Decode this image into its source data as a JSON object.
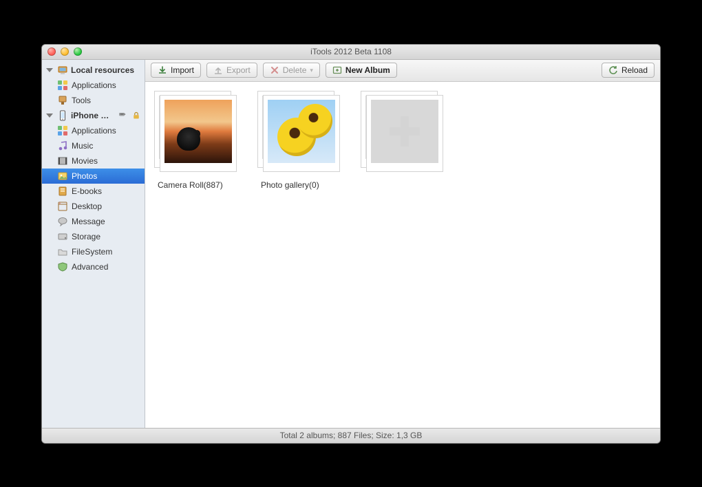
{
  "window": {
    "title": "iTools 2012 Beta 1108"
  },
  "sidebar": {
    "group1": {
      "label": "Local resources",
      "items": [
        {
          "label": "Applications"
        },
        {
          "label": "Tools"
        }
      ]
    },
    "group2": {
      "label": "iPhone de...",
      "items": [
        {
          "label": "Applications"
        },
        {
          "label": "Music"
        },
        {
          "label": "Movies"
        },
        {
          "label": "Photos"
        },
        {
          "label": "E-books"
        },
        {
          "label": "Desktop"
        },
        {
          "label": "Message"
        },
        {
          "label": "Storage"
        },
        {
          "label": "FileSystem"
        },
        {
          "label": "Advanced"
        }
      ]
    }
  },
  "toolbar": {
    "import": "Import",
    "export": "Export",
    "delete": "Delete",
    "new_album": "New Album",
    "reload": "Reload"
  },
  "albums": [
    {
      "label": "Camera Roll(887)"
    },
    {
      "label": "Photo gallery(0)"
    }
  ],
  "status": "Total 2 albums; 887 Files;  Size: 1,3 GB"
}
